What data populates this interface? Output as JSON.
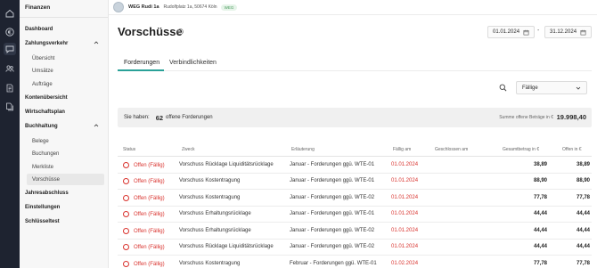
{
  "rail": {
    "icons": [
      "home-icon",
      "euro-icon",
      "chat-icon",
      "people-icon",
      "document-icon",
      "files-icon"
    ]
  },
  "sidebar": {
    "title": "Finanzen",
    "items": [
      {
        "label": "Dashboard"
      },
      {
        "label": "Zahlungsverkehr"
      },
      {
        "label": "Übersicht"
      },
      {
        "label": "Umsätze"
      },
      {
        "label": "Aufträge"
      },
      {
        "label": "Kontenübersicht"
      },
      {
        "label": "Wirtschaftsplan"
      },
      {
        "label": "Buchhaltung"
      },
      {
        "label": "Belege"
      },
      {
        "label": "Buchungen"
      },
      {
        "label": "Merkliste"
      },
      {
        "label": "Vorschüsse"
      },
      {
        "label": "Jahresabschluss"
      },
      {
        "label": "Einstellungen"
      },
      {
        "label": "Schlüsseltest"
      }
    ]
  },
  "topbar": {
    "property_name": "WEG Rudi 1a",
    "address": "Rudolfplatz 1a, 50674 Köln",
    "badge": "WEG"
  },
  "page": {
    "title": "Vorschüsse",
    "date_from": "01.01.2024",
    "date_sep": "-",
    "date_to": "31.12.2024"
  },
  "tabs": [
    {
      "label": "Forderungen"
    },
    {
      "label": "Verbindlichkeiten"
    }
  ],
  "filter": {
    "selected": "Fällige"
  },
  "summary": {
    "prefix": "Sie haben:",
    "count": "62",
    "suffix": "offene Forderungen",
    "total_label": "Summe offene Beträge in €",
    "total_value": "19.998,40"
  },
  "table": {
    "headers": [
      "Status",
      "Zweck",
      "Erläuterung",
      "Fällig am",
      "Geschlossen am",
      "Gesamtbetrag in €",
      "Offen in €"
    ],
    "rows": [
      {
        "status": "Offen (Fällig)",
        "zweck": "Vorschuss Rücklage Liquiditätsrücklage",
        "erlaeuterung": "Januar - Forderungen ggü. WTE-01",
        "faellig": "01.01.2024",
        "geschlossen": "",
        "gesamt": "38,89",
        "offen": "38,89"
      },
      {
        "status": "Offen (Fällig)",
        "zweck": "Vorschuss Kostentragung",
        "erlaeuterung": "Januar - Forderungen ggü. WTE-01",
        "faellig": "01.01.2024",
        "geschlossen": "",
        "gesamt": "88,90",
        "offen": "88,90"
      },
      {
        "status": "Offen (Fällig)",
        "zweck": "Vorschuss Kostentragung",
        "erlaeuterung": "Januar - Forderungen ggü. WTE-02",
        "faellig": "01.01.2024",
        "geschlossen": "",
        "gesamt": "77,78",
        "offen": "77,78"
      },
      {
        "status": "Offen (Fällig)",
        "zweck": "Vorschuss Erhaltungsrücklage",
        "erlaeuterung": "Januar - Forderungen ggü. WTE-01",
        "faellig": "01.01.2024",
        "geschlossen": "",
        "gesamt": "44,44",
        "offen": "44,44"
      },
      {
        "status": "Offen (Fällig)",
        "zweck": "Vorschuss Erhaltungsrücklage",
        "erlaeuterung": "Januar - Forderungen ggü. WTE-02",
        "faellig": "01.01.2024",
        "geschlossen": "",
        "gesamt": "44,44",
        "offen": "44,44"
      },
      {
        "status": "Offen (Fällig)",
        "zweck": "Vorschuss Rücklage Liquiditätsrücklage",
        "erlaeuterung": "Januar - Forderungen ggü. WTE-02",
        "faellig": "01.01.2024",
        "geschlossen": "",
        "gesamt": "44,44",
        "offen": "44,44"
      },
      {
        "status": "Offen (Fällig)",
        "zweck": "Vorschuss Kostentragung",
        "erlaeuterung": "Februar - Forderungen ggü. WTE-01",
        "faellig": "01.02.2024",
        "geschlossen": "",
        "gesamt": "77,78",
        "offen": "77,78"
      }
    ]
  }
}
